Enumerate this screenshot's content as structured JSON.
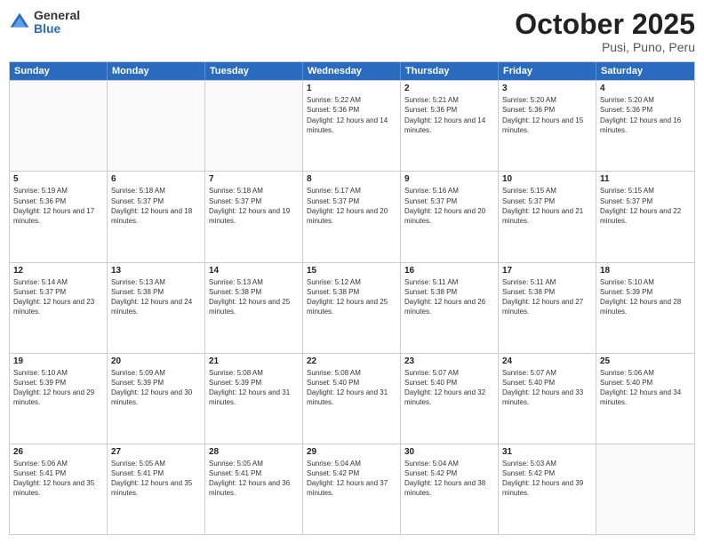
{
  "logo": {
    "general": "General",
    "blue": "Blue"
  },
  "title": {
    "month": "October 2025",
    "location": "Pusi, Puno, Peru"
  },
  "weekdays": [
    "Sunday",
    "Monday",
    "Tuesday",
    "Wednesday",
    "Thursday",
    "Friday",
    "Saturday"
  ],
  "weeks": [
    [
      {
        "day": "",
        "info": ""
      },
      {
        "day": "",
        "info": ""
      },
      {
        "day": "",
        "info": ""
      },
      {
        "day": "1",
        "info": "Sunrise: 5:22 AM\nSunset: 5:36 PM\nDaylight: 12 hours and 14 minutes."
      },
      {
        "day": "2",
        "info": "Sunrise: 5:21 AM\nSunset: 5:36 PM\nDaylight: 12 hours and 14 minutes."
      },
      {
        "day": "3",
        "info": "Sunrise: 5:20 AM\nSunset: 5:36 PM\nDaylight: 12 hours and 15 minutes."
      },
      {
        "day": "4",
        "info": "Sunrise: 5:20 AM\nSunset: 5:36 PM\nDaylight: 12 hours and 16 minutes."
      }
    ],
    [
      {
        "day": "5",
        "info": "Sunrise: 5:19 AM\nSunset: 5:36 PM\nDaylight: 12 hours and 17 minutes."
      },
      {
        "day": "6",
        "info": "Sunrise: 5:18 AM\nSunset: 5:37 PM\nDaylight: 12 hours and 18 minutes."
      },
      {
        "day": "7",
        "info": "Sunrise: 5:18 AM\nSunset: 5:37 PM\nDaylight: 12 hours and 19 minutes."
      },
      {
        "day": "8",
        "info": "Sunrise: 5:17 AM\nSunset: 5:37 PM\nDaylight: 12 hours and 20 minutes."
      },
      {
        "day": "9",
        "info": "Sunrise: 5:16 AM\nSunset: 5:37 PM\nDaylight: 12 hours and 20 minutes."
      },
      {
        "day": "10",
        "info": "Sunrise: 5:15 AM\nSunset: 5:37 PM\nDaylight: 12 hours and 21 minutes."
      },
      {
        "day": "11",
        "info": "Sunrise: 5:15 AM\nSunset: 5:37 PM\nDaylight: 12 hours and 22 minutes."
      }
    ],
    [
      {
        "day": "12",
        "info": "Sunrise: 5:14 AM\nSunset: 5:37 PM\nDaylight: 12 hours and 23 minutes."
      },
      {
        "day": "13",
        "info": "Sunrise: 5:13 AM\nSunset: 5:38 PM\nDaylight: 12 hours and 24 minutes."
      },
      {
        "day": "14",
        "info": "Sunrise: 5:13 AM\nSunset: 5:38 PM\nDaylight: 12 hours and 25 minutes."
      },
      {
        "day": "15",
        "info": "Sunrise: 5:12 AM\nSunset: 5:38 PM\nDaylight: 12 hours and 25 minutes."
      },
      {
        "day": "16",
        "info": "Sunrise: 5:11 AM\nSunset: 5:38 PM\nDaylight: 12 hours and 26 minutes."
      },
      {
        "day": "17",
        "info": "Sunrise: 5:11 AM\nSunset: 5:38 PM\nDaylight: 12 hours and 27 minutes."
      },
      {
        "day": "18",
        "info": "Sunrise: 5:10 AM\nSunset: 5:39 PM\nDaylight: 12 hours and 28 minutes."
      }
    ],
    [
      {
        "day": "19",
        "info": "Sunrise: 5:10 AM\nSunset: 5:39 PM\nDaylight: 12 hours and 29 minutes."
      },
      {
        "day": "20",
        "info": "Sunrise: 5:09 AM\nSunset: 5:39 PM\nDaylight: 12 hours and 30 minutes."
      },
      {
        "day": "21",
        "info": "Sunrise: 5:08 AM\nSunset: 5:39 PM\nDaylight: 12 hours and 31 minutes."
      },
      {
        "day": "22",
        "info": "Sunrise: 5:08 AM\nSunset: 5:40 PM\nDaylight: 12 hours and 31 minutes."
      },
      {
        "day": "23",
        "info": "Sunrise: 5:07 AM\nSunset: 5:40 PM\nDaylight: 12 hours and 32 minutes."
      },
      {
        "day": "24",
        "info": "Sunrise: 5:07 AM\nSunset: 5:40 PM\nDaylight: 12 hours and 33 minutes."
      },
      {
        "day": "25",
        "info": "Sunrise: 5:06 AM\nSunset: 5:40 PM\nDaylight: 12 hours and 34 minutes."
      }
    ],
    [
      {
        "day": "26",
        "info": "Sunrise: 5:06 AM\nSunset: 5:41 PM\nDaylight: 12 hours and 35 minutes."
      },
      {
        "day": "27",
        "info": "Sunrise: 5:05 AM\nSunset: 5:41 PM\nDaylight: 12 hours and 35 minutes."
      },
      {
        "day": "28",
        "info": "Sunrise: 5:05 AM\nSunset: 5:41 PM\nDaylight: 12 hours and 36 minutes."
      },
      {
        "day": "29",
        "info": "Sunrise: 5:04 AM\nSunset: 5:42 PM\nDaylight: 12 hours and 37 minutes."
      },
      {
        "day": "30",
        "info": "Sunrise: 5:04 AM\nSunset: 5:42 PM\nDaylight: 12 hours and 38 minutes."
      },
      {
        "day": "31",
        "info": "Sunrise: 5:03 AM\nSunset: 5:42 PM\nDaylight: 12 hours and 39 minutes."
      },
      {
        "day": "",
        "info": ""
      }
    ]
  ]
}
